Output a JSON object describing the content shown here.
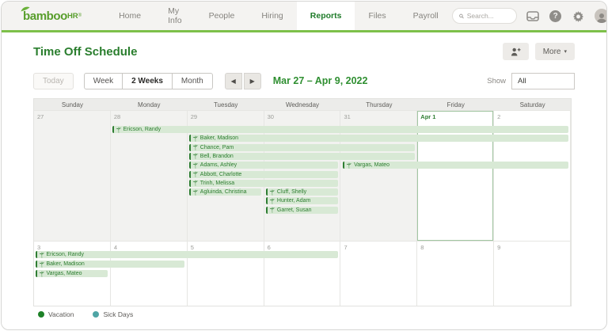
{
  "nav": {
    "logo_main": "bamboo",
    "logo_hr": "HR",
    "logo_reg": "®",
    "items": [
      {
        "label": "Home",
        "active": false
      },
      {
        "label": "My Info",
        "active": false
      },
      {
        "label": "People",
        "active": false
      },
      {
        "label": "Hiring",
        "active": false
      },
      {
        "label": "Reports",
        "active": true
      },
      {
        "label": "Files",
        "active": false
      },
      {
        "label": "Payroll",
        "active": false
      }
    ],
    "search_placeholder": "Search..."
  },
  "page": {
    "title": "Time Off Schedule",
    "more_label": "More",
    "more_caret": "▾"
  },
  "toolbar": {
    "today_label": "Today",
    "views": [
      {
        "label": "Week",
        "selected": false
      },
      {
        "label": "2 Weeks",
        "selected": true
      },
      {
        "label": "Month",
        "selected": false
      }
    ],
    "prev_arrow": "◀",
    "next_arrow": "▶",
    "range": "Mar 27 – Apr 9, 2022",
    "show_label": "Show",
    "show_value": "All"
  },
  "calendar": {
    "day_headers": [
      "Sunday",
      "Monday",
      "Tuesday",
      "Wednesday",
      "Thursday",
      "Friday",
      "Saturday"
    ],
    "weeks": [
      {
        "cells": [
          {
            "date": "27",
            "muted": true
          },
          {
            "date": "28",
            "muted": true
          },
          {
            "date": "29",
            "muted": true
          },
          {
            "date": "30",
            "muted": true
          },
          {
            "date": "31",
            "muted": true
          },
          {
            "date": "Apr 1",
            "today": true
          },
          {
            "date": "2"
          }
        ],
        "events": [
          {
            "row": 0,
            "start": 1,
            "span": 6,
            "label": "Ericson, Randy"
          },
          {
            "row": 1,
            "start": 2,
            "span": 5,
            "label": "Baker, Madison"
          },
          {
            "row": 2,
            "start": 2,
            "span": 3,
            "label": "Chance, Pam"
          },
          {
            "row": 3,
            "start": 2,
            "span": 3,
            "label": "Bell, Brandon"
          },
          {
            "row": 4,
            "start": 2,
            "span": 2,
            "label": "Adams, Ashley"
          },
          {
            "row": 4,
            "start": 4,
            "span": 3,
            "label": "Vargas, Mateo"
          },
          {
            "row": 5,
            "start": 2,
            "span": 2,
            "label": "Abbott, Charlotte"
          },
          {
            "row": 6,
            "start": 2,
            "span": 2,
            "label": "Trinh, Melissa"
          },
          {
            "row": 7,
            "start": 2,
            "span": 1,
            "label": "Agluinda, Christina"
          },
          {
            "row": 7,
            "start": 3,
            "span": 1,
            "label": "Cluff, Shelly"
          },
          {
            "row": 8,
            "start": 3,
            "span": 1,
            "label": "Hunter, Adam"
          },
          {
            "row": 9,
            "start": 3,
            "span": 1,
            "label": "Garret, Susan"
          }
        ]
      },
      {
        "cells": [
          {
            "date": "3"
          },
          {
            "date": "4"
          },
          {
            "date": "5"
          },
          {
            "date": "6"
          },
          {
            "date": "7"
          },
          {
            "date": "8"
          },
          {
            "date": "9"
          }
        ],
        "events": [
          {
            "row": 0,
            "start": 0,
            "span": 4,
            "label": "Ericson, Randy"
          },
          {
            "row": 1,
            "start": 0,
            "span": 2,
            "label": "Baker, Madison"
          },
          {
            "row": 2,
            "start": 0,
            "span": 1,
            "label": "Vargas, Mateo"
          }
        ]
      }
    ]
  },
  "legend": [
    {
      "label": "Vacation",
      "color": "#1d8127"
    },
    {
      "label": "Sick Days",
      "color": "#4fa5a5"
    }
  ],
  "colors": {
    "accent_green": "#7dc04a",
    "event_bar": "#d8e9d5",
    "event_text": "#2b7d2e"
  }
}
